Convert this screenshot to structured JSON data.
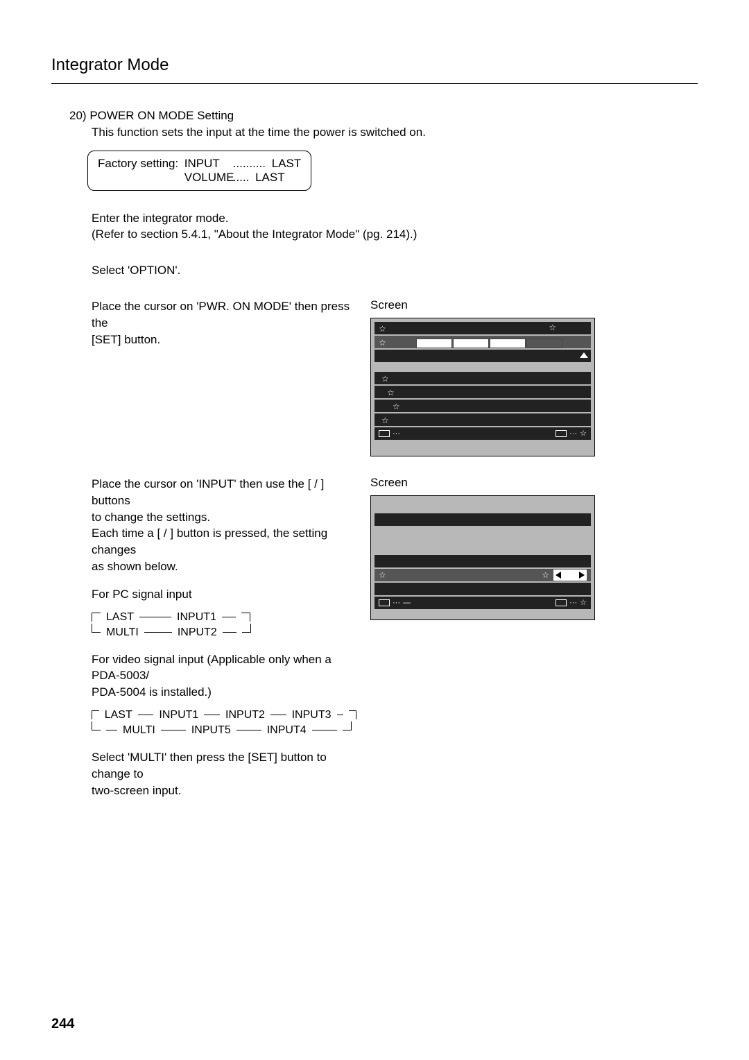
{
  "title": "Integrator Mode",
  "section": {
    "number": "20)",
    "heading": "POWER ON MODE Setting",
    "desc": "This function sets the input at the time the power is switched on."
  },
  "factory": {
    "label": "Factory setting:",
    "rows": [
      {
        "name": "INPUT",
        "dots": "..........",
        "value": "LAST"
      },
      {
        "name": "VOLUME",
        "dots": ".....",
        "value": "LAST"
      }
    ]
  },
  "steps": {
    "enter": "Enter the integrator mode.",
    "refer": "(Refer to section 5.4.1, \"About the Integrator Mode\" (pg. 214).)",
    "selectOption": "Select 'OPTION'.",
    "placeCursor1a": "Place the cursor on 'PWR. ON MODE' then press the",
    "placeCursor1b": "[SET] button.",
    "placeCursor2a": "Place the cursor on 'INPUT' then use the [   /   ] buttons",
    "placeCursor2b": "to change the settings.",
    "eachTimeA": "Each time a [   /   ] button is pressed, the setting changes",
    "eachTimeB": "as shown below.",
    "forPC": "For PC signal input",
    "forVideoA": "For video signal input (Applicable only when a PDA-5003/",
    "forVideoB": "PDA-5004 is installed.)",
    "selectMultiA": "Select 'MULTI' then press the [SET] button to change to",
    "selectMultiB": "two-screen input."
  },
  "flow_pc": {
    "top": [
      "LAST",
      "INPUT1"
    ],
    "bot": [
      "MULTI",
      "INPUT2"
    ]
  },
  "flow_video": {
    "top": [
      "LAST",
      "INPUT1",
      "INPUT2",
      "INPUT3"
    ],
    "bot": [
      "MULTI",
      "INPUT5",
      "INPUT4"
    ]
  },
  "screen_label": "Screen",
  "page_number": "244",
  "icons": {
    "star": "☆",
    "dots": "···",
    "dash": "—"
  }
}
